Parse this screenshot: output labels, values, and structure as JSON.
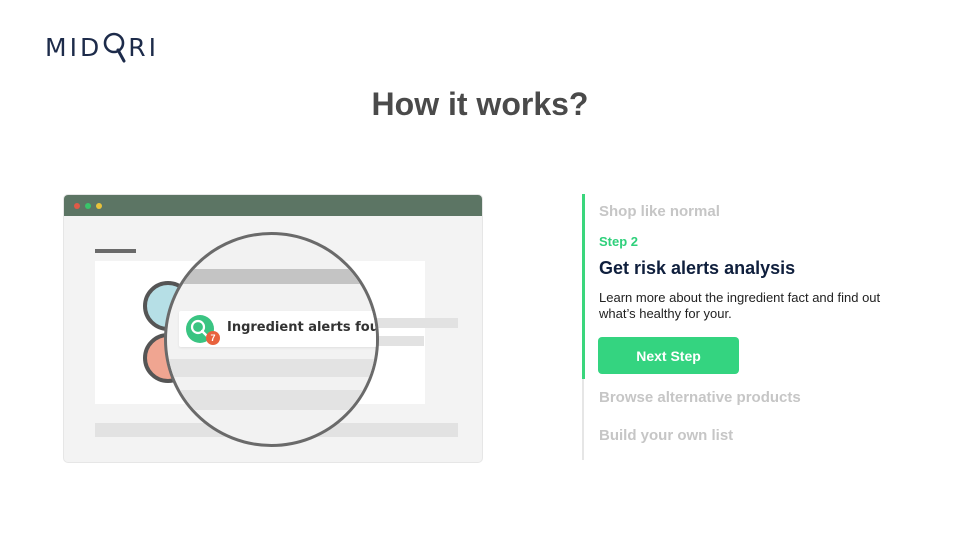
{
  "brand": {
    "logo_text_left": "MID",
    "logo_text_right": "RI",
    "logo_glyph": "magnifier-o-icon"
  },
  "page": {
    "title": "How it works?"
  },
  "illustration": {
    "window_dots": [
      "#e05a47",
      "#39c46a",
      "#e9c23a"
    ],
    "alert": {
      "count": "7",
      "text": "Ingredient alerts found",
      "icon": "search-icon"
    }
  },
  "steps": {
    "step1_label": "Shop like normal",
    "current": {
      "number_label": "Step 2",
      "title": "Get risk alerts analysis",
      "description": "Learn more about the ingredient fact and find out what’s healthy for your.",
      "button_label": "Next Step"
    },
    "step3_label": "Browse alternative products",
    "step4_label": "Build your own list"
  },
  "colors": {
    "accent": "#34d480",
    "heading": "#0f1f3d",
    "inactive": "#c6c6c6",
    "browser_bar": "#5c7564"
  }
}
